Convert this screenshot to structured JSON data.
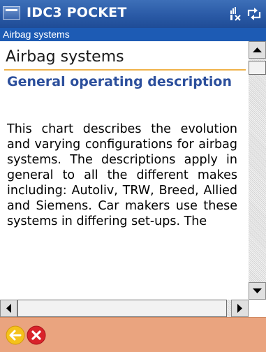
{
  "window": {
    "app_title": "IDC3 POCKET",
    "start_icon": "windows-flag-icon",
    "status_icons": [
      "signal-icon",
      "sync-icon"
    ]
  },
  "subtitle": {
    "text": "Airbag systems"
  },
  "document": {
    "title": "Airbag systems",
    "heading": "General operating description",
    "body": "This chart describes the evolution and varying configurations for airbag systems. The descriptions apply in general to all the different makes including: Autoliv, TRW, Breed, Allied and Siemens. Car makers use these systems in differing set-ups. The"
  },
  "scrollbars": {
    "vertical_position": 0.0,
    "horizontal_position": 0.0
  },
  "toolbar": {
    "buttons": [
      {
        "icon": "back-arrow-icon",
        "color": "#f5c21b"
      },
      {
        "icon": "close-x-icon",
        "color": "#d9232a"
      }
    ]
  },
  "colors": {
    "title_bar": "#2a5aa6",
    "subtitle_bar": "#1d5bb4",
    "heading_text": "#2c4f9c",
    "title_rule": "#f0b24a",
    "toolbar": "#eaa47f"
  }
}
